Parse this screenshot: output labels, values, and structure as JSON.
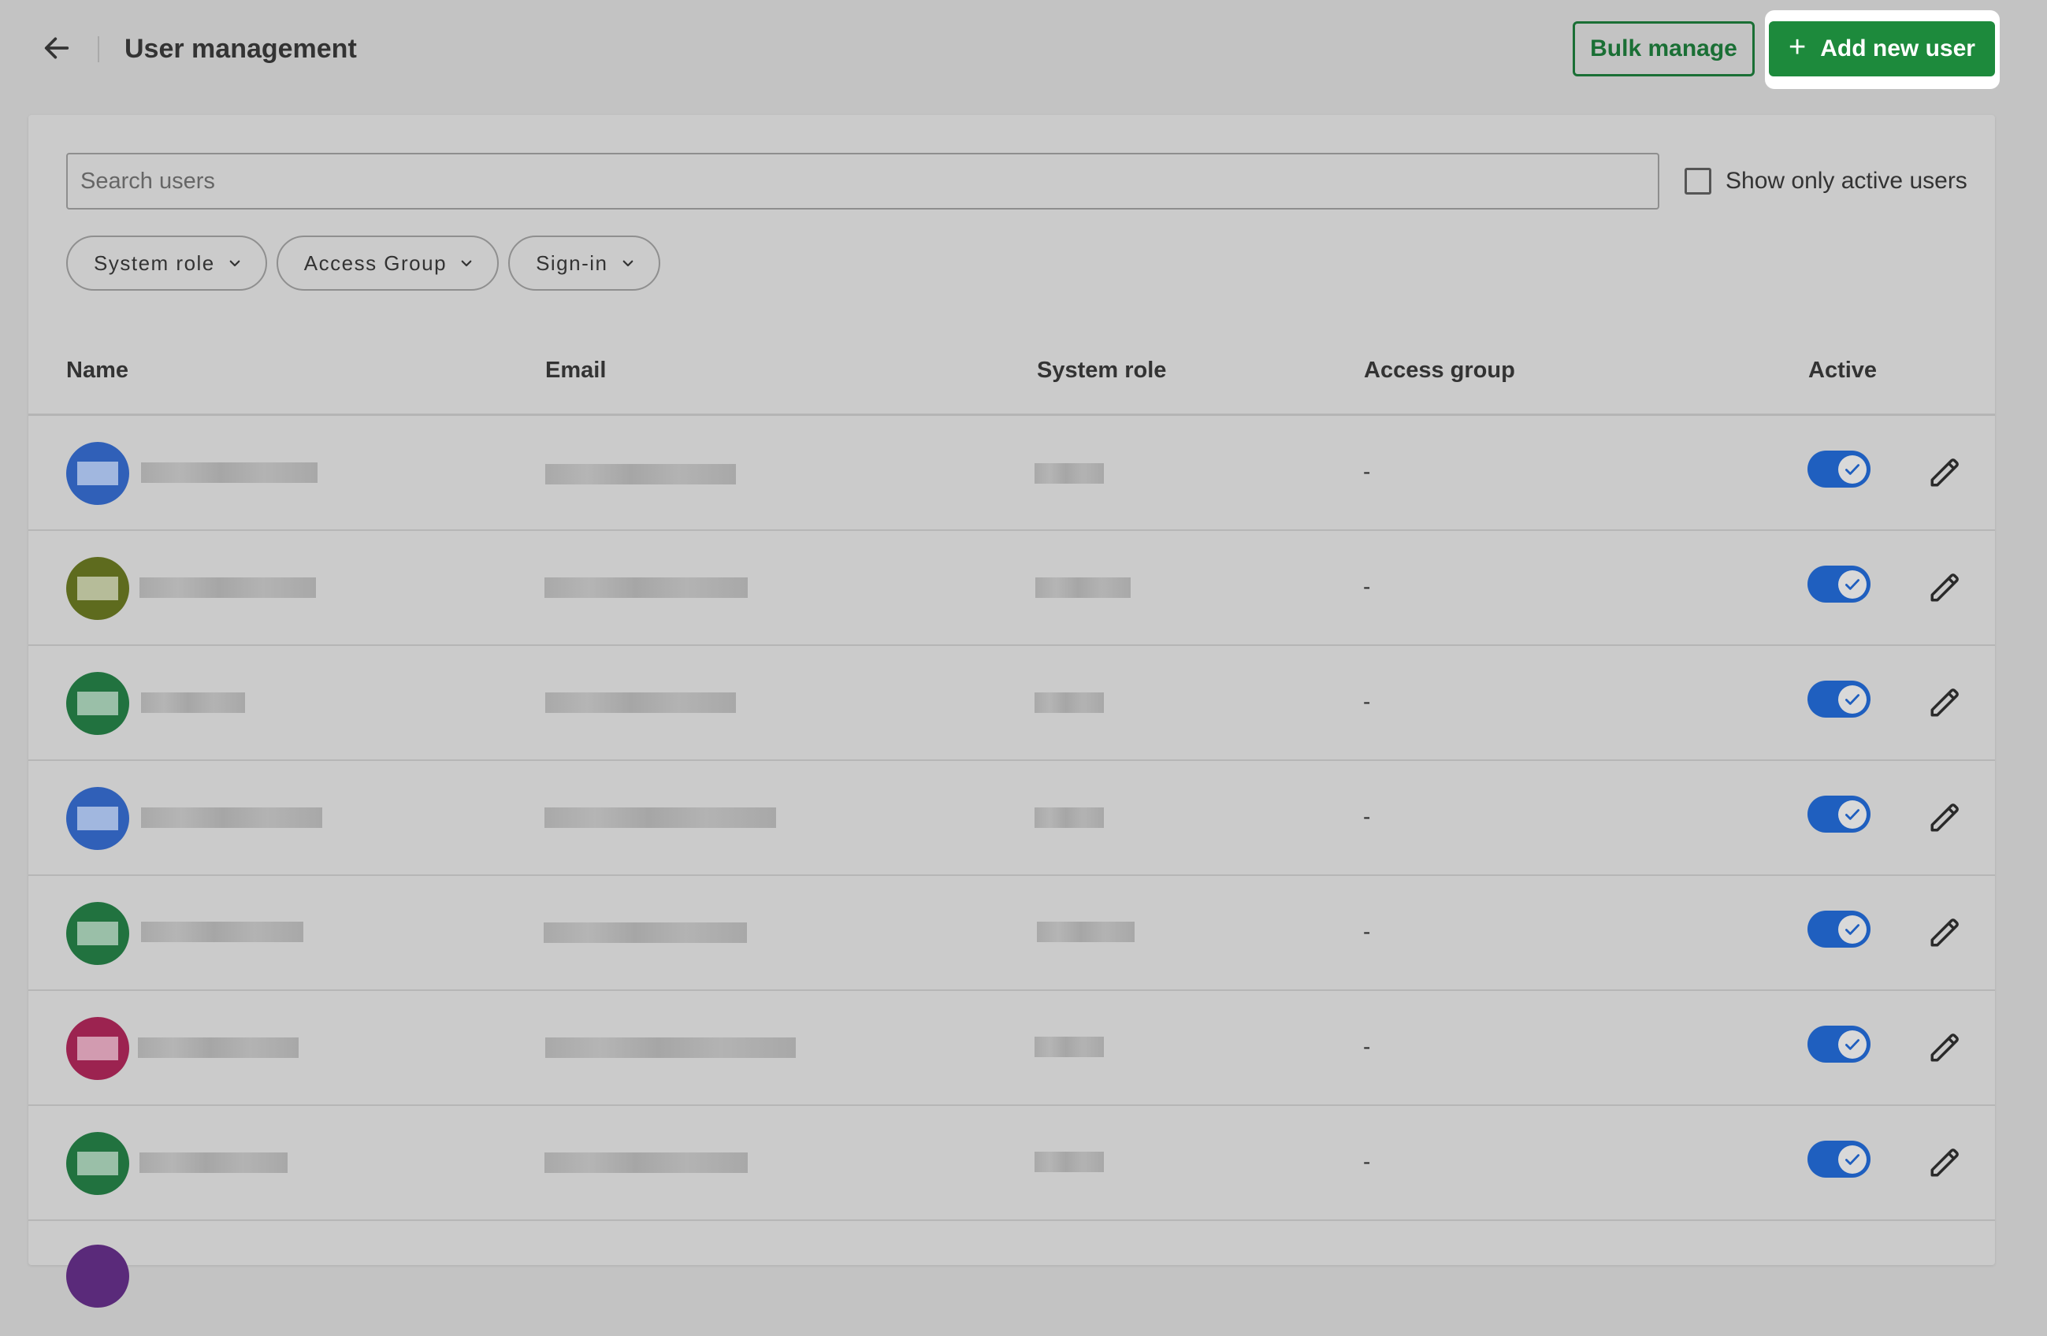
{
  "header": {
    "title": "User management",
    "bulk_label": "Bulk manage",
    "add_label": "Add new user",
    "add_icon": "+"
  },
  "search": {
    "placeholder": "Search users",
    "value": ""
  },
  "active_filter": {
    "label": "Show only active users",
    "checked": false
  },
  "filters": [
    {
      "label": "System role"
    },
    {
      "label": "Access Group"
    },
    {
      "label": "Sign-in"
    }
  ],
  "columns": {
    "name": "Name",
    "email": "Email",
    "role": "System role",
    "group": "Access group",
    "active": "Active"
  },
  "colors": {
    "primary_green": "#1d8a3c",
    "toggle_blue": "#1f5fbf"
  },
  "rows": [
    {
      "avatar_color": "#3060b8",
      "access_group": "-",
      "active": true
    },
    {
      "avatar_color": "#5e6b1e",
      "access_group": "-",
      "active": true
    },
    {
      "avatar_color": "#21723f",
      "access_group": "-",
      "active": true
    },
    {
      "avatar_color": "#3060b8",
      "access_group": "-",
      "active": true
    },
    {
      "avatar_color": "#21723f",
      "access_group": "-",
      "active": true
    },
    {
      "avatar_color": "#9c2350",
      "access_group": "-",
      "active": true
    },
    {
      "avatar_color": "#21723f",
      "access_group": "-",
      "active": true
    }
  ]
}
